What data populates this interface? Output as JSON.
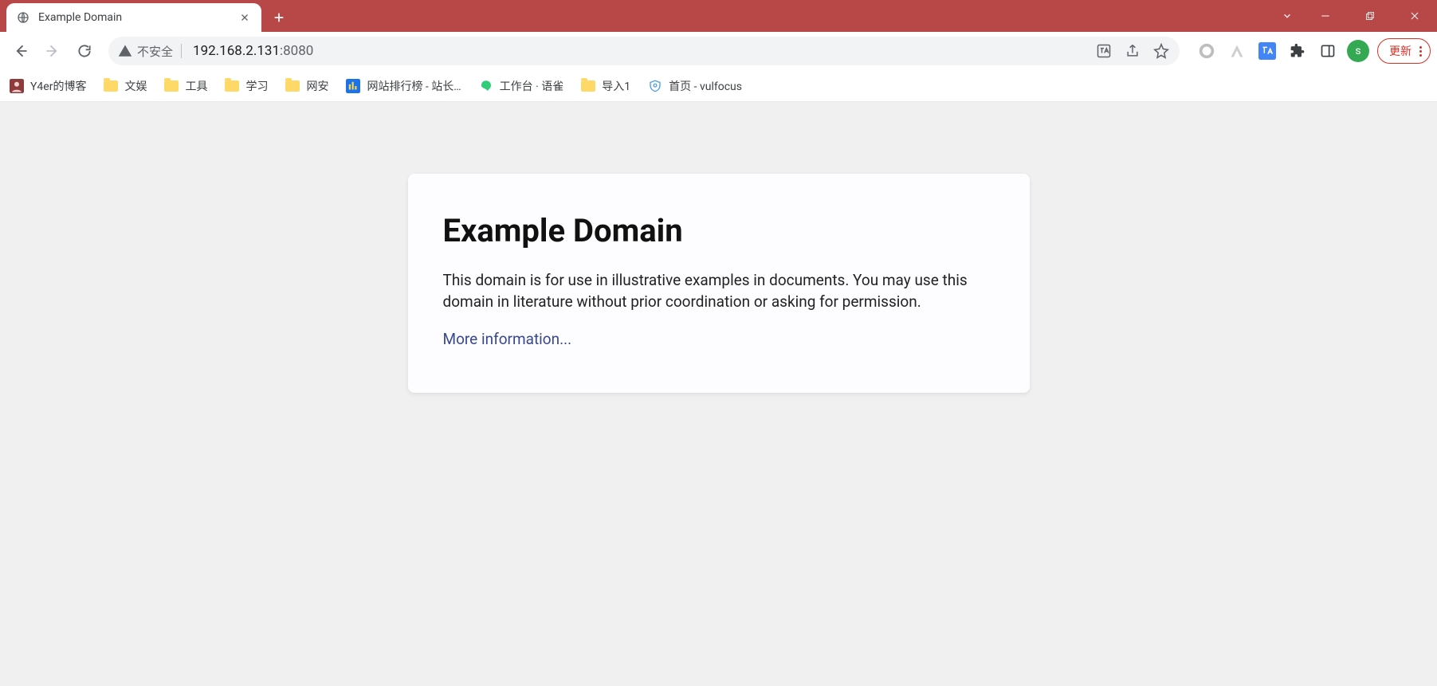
{
  "browser": {
    "tab": {
      "title": "Example Domain"
    },
    "address": {
      "insecure_label": "不安全",
      "host": "192.168.2.131",
      "port": ":8080"
    },
    "update_label": "更新",
    "avatar_initial": "s",
    "bookmarks": [
      {
        "label": "Y4er的博客",
        "icon": "avatar"
      },
      {
        "label": "文娱",
        "icon": "folder"
      },
      {
        "label": "工具",
        "icon": "folder"
      },
      {
        "label": "学习",
        "icon": "folder"
      },
      {
        "label": "网安",
        "icon": "folder"
      },
      {
        "label": "网站排行榜 - 站长…",
        "icon": "site-blue"
      },
      {
        "label": "工作台 · 语雀",
        "icon": "yuque"
      },
      {
        "label": "导入1",
        "icon": "folder"
      },
      {
        "label": "首页 - vulfocus",
        "icon": "shield"
      }
    ]
  },
  "page": {
    "heading": "Example Domain",
    "body": "This domain is for use in illustrative examples in documents. You may use this domain in literature without prior coordination or asking for permission.",
    "link": "More information..."
  }
}
